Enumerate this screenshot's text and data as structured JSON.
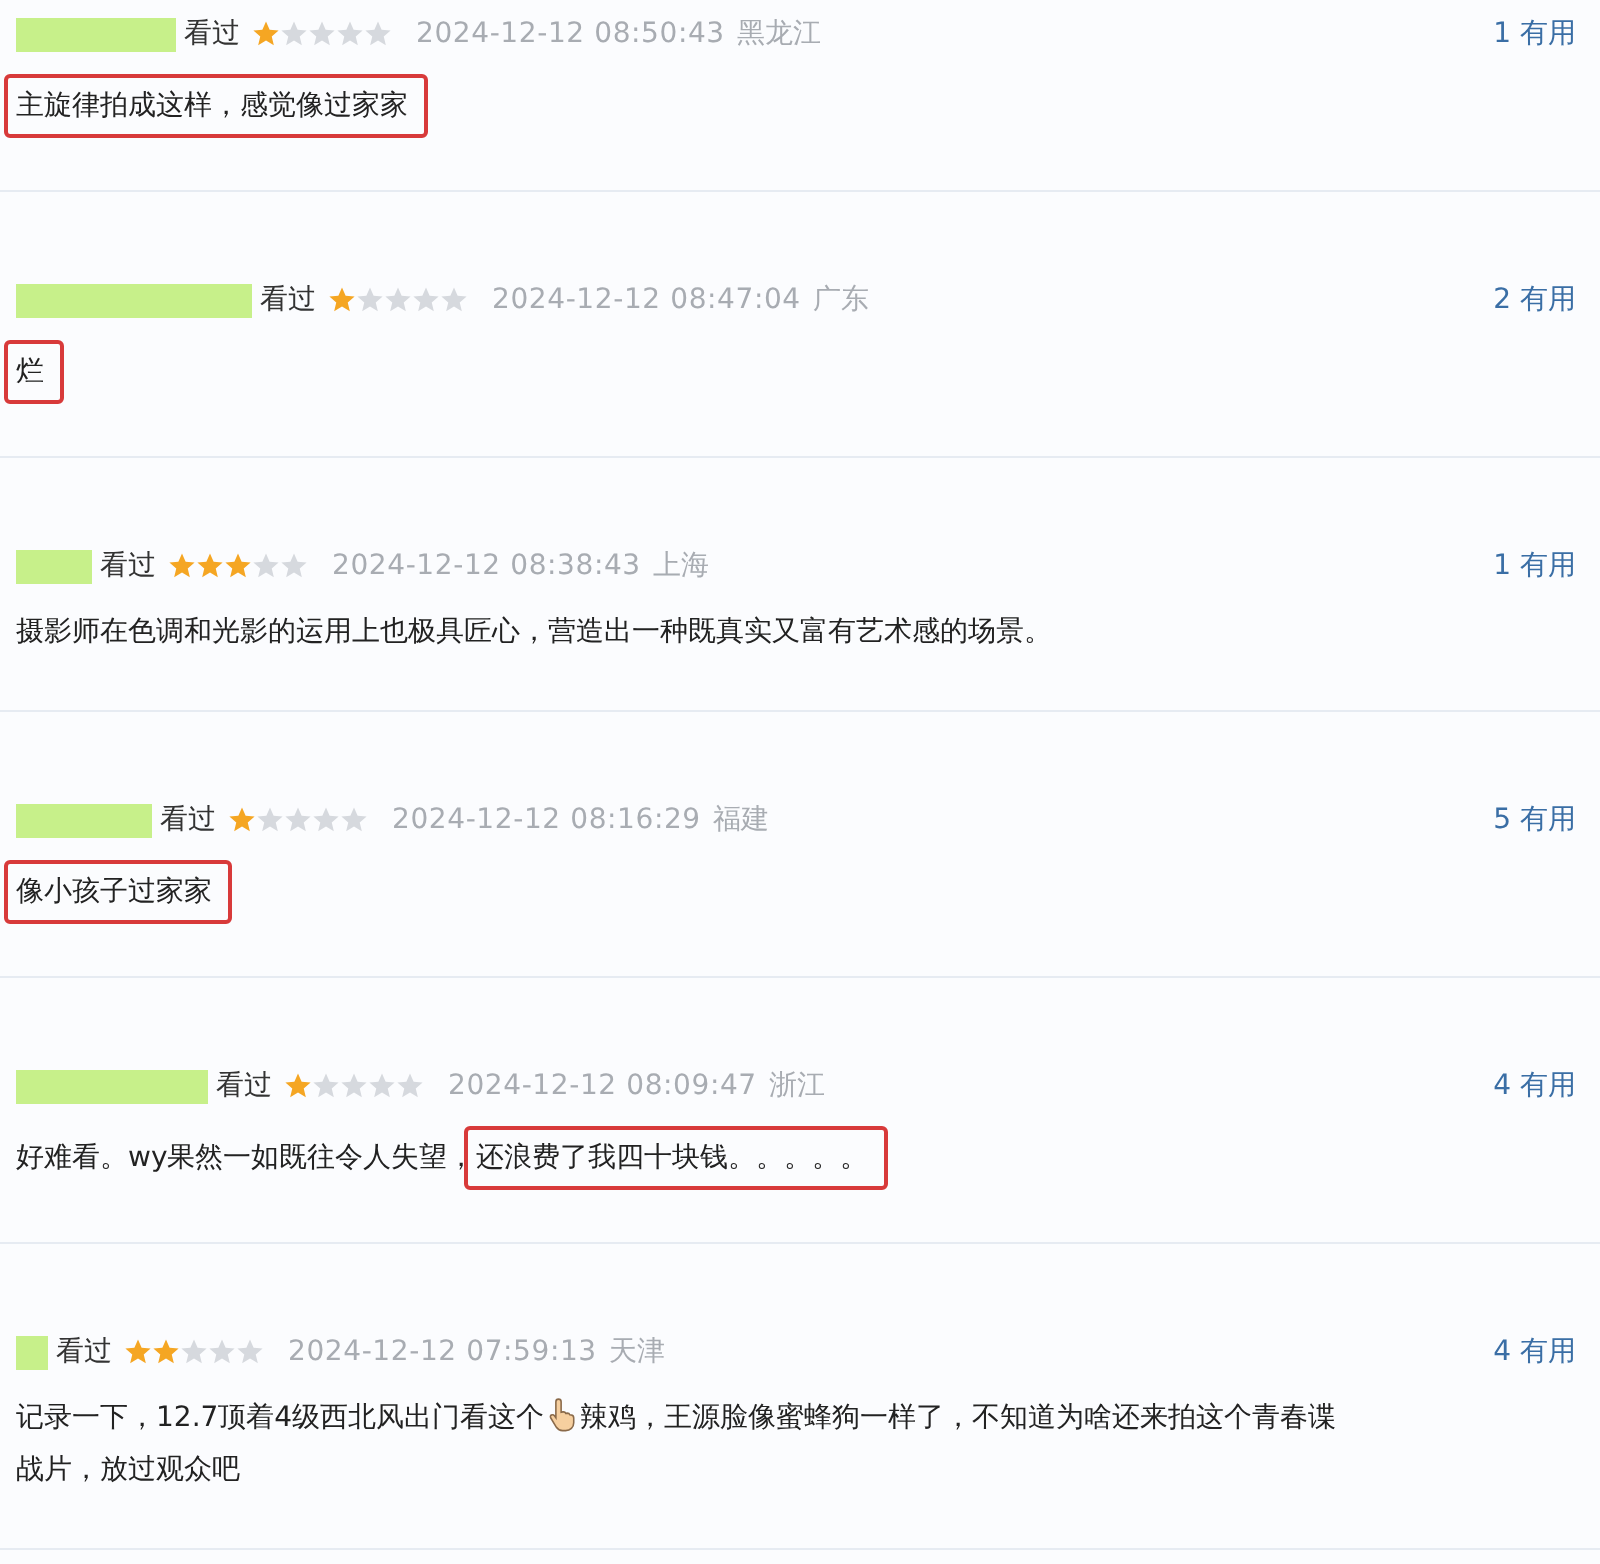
{
  "reviews": [
    {
      "status": "看过",
      "stars": 1,
      "time": "2024-12-12 08:50:43",
      "location": "黑龙江",
      "useful_count": "1",
      "useful_label": "有用",
      "comment": [
        {
          "kind": "text",
          "text": "主旋律拍成这样，感觉像过家家",
          "highlighted": true
        }
      ]
    },
    {
      "status": "看过",
      "stars": 1,
      "time": "2024-12-12 08:47:04",
      "location": "广东",
      "useful_count": "2",
      "useful_label": "有用",
      "comment": [
        {
          "kind": "text",
          "text": "烂",
          "highlighted": true
        }
      ]
    },
    {
      "status": "看过",
      "stars": 3,
      "time": "2024-12-12 08:38:43",
      "location": "上海",
      "useful_count": "1",
      "useful_label": "有用",
      "comment": [
        {
          "kind": "text",
          "text": "摄影师在色调和光影的运用上也极具匠心，营造出一种既真实又富有艺术感的场景。",
          "highlighted": false
        }
      ]
    },
    {
      "status": "看过",
      "stars": 1,
      "time": "2024-12-12 08:16:29",
      "location": "福建",
      "useful_count": "5",
      "useful_label": "有用",
      "comment": [
        {
          "kind": "text",
          "text": "像小孩子过家家",
          "highlighted": true
        }
      ]
    },
    {
      "status": "看过",
      "stars": 1,
      "time": "2024-12-12 08:09:47",
      "location": "浙江",
      "useful_count": "4",
      "useful_label": "有用",
      "comment": [
        {
          "kind": "text",
          "text": "好难看。wy果然一如既往令人失望，",
          "highlighted": false
        },
        {
          "kind": "text",
          "text": "还浪费了我四十块钱。。。。。",
          "highlighted": true
        }
      ]
    },
    {
      "status": "看过",
      "stars": 2,
      "time": "2024-12-12 07:59:13",
      "location": "天津",
      "useful_count": "4",
      "useful_label": "有用",
      "comment": [
        {
          "kind": "text",
          "text": "记录一下，12.7顶着4级西北风出门看这个",
          "highlighted": false
        },
        {
          "kind": "icon"
        },
        {
          "kind": "text",
          "text": "辣鸡，王源脸像蜜蜂狗一样了，不知道为啥还来拍这个青春谍",
          "highlighted": false
        },
        {
          "kind": "break"
        },
        {
          "kind": "text",
          "text": "战片，放过观众吧",
          "highlighted": false
        }
      ]
    }
  ]
}
